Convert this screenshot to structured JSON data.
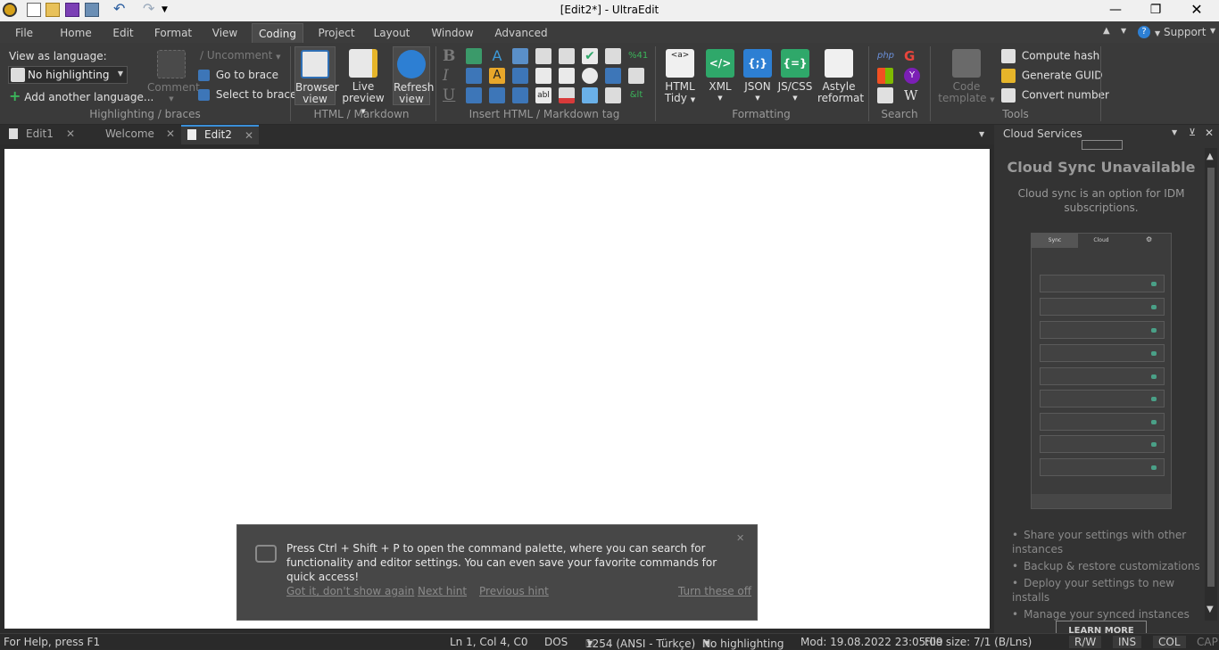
{
  "window": {
    "title": "[Edit2*] - UltraEdit"
  },
  "ribbon_tabs": [
    "File",
    "Home",
    "Edit",
    "Format",
    "View",
    "Coding",
    "Project",
    "Layout",
    "Window",
    "Advanced"
  ],
  "ribbon_right": {
    "support": "Support"
  },
  "highlighting": {
    "view_as_label": "View as language:",
    "language_value": "No highlighting",
    "add_language": "Add another language...",
    "comment": "Comment",
    "uncomment": "Uncomment",
    "go_to_brace": "Go to brace",
    "select_to_brace": "Select to brace",
    "group_label": "Highlighting / braces"
  },
  "html_markdown": {
    "browser_view": [
      "Browser",
      "view"
    ],
    "live_preview": [
      "Live",
      "preview"
    ],
    "refresh_view": [
      "Refresh",
      "view"
    ],
    "group_label": "HTML / Markdown"
  },
  "insert_tag": {
    "group_label": "Insert HTML / Markdown tag"
  },
  "formatting": {
    "html_tidy": [
      "HTML",
      "Tidy"
    ],
    "xml": "XML",
    "json": "JSON",
    "jscss": "JS/CSS",
    "astyle": [
      "Astyle",
      "reformat"
    ],
    "group_label": "Formatting",
    "xml_icon": "</>",
    "json_icon": "{;}",
    "jscss_icon": "{=}"
  },
  "search": {
    "group_label": "Search"
  },
  "tools": {
    "code_template": [
      "Code",
      "template"
    ],
    "compute_hash": "Compute hash",
    "generate_guid": "Generate GUID",
    "convert_number": "Convert number",
    "group_label": "Tools"
  },
  "doc_tabs": [
    {
      "label": "Edit1"
    },
    {
      "label": "Welcome"
    },
    {
      "label": "Edit2"
    }
  ],
  "hint": {
    "message": "Press Ctrl + Shift + P to open the command palette, where you can search for functionality and editor settings. You can even save your favorite commands for quick access!",
    "got_it": "Got it, don't show again",
    "next_hint": "Next hint",
    "previous_hint": "Previous hint",
    "turn_off": "Turn these off"
  },
  "cloud_panel": {
    "header": "Cloud Services",
    "title": "Cloud Sync Unavailable",
    "subtitle": "Cloud sync is an option for IDM subscriptions.",
    "preview_tabs": [
      "Sync",
      "Cloud"
    ],
    "bullets": [
      "Share your settings with other instances",
      "Backup & restore customizations",
      "Deploy your settings to new installs",
      "Manage your synced instances"
    ],
    "learn_more": "LEARN MORE"
  },
  "status": {
    "help": "For Help, press F1",
    "position": "Ln 1, Col 4, C0",
    "line_ending": "DOS",
    "encoding": "1254  (ANSI - Türkçe)",
    "highlighting": "No highlighting",
    "modified": "Mod: 19.08.2022 23:05:09",
    "file_size": "File size: 7/1 (B/Lns)",
    "rw": "R/W",
    "ins": "INS",
    "col": "COL",
    "cap": "CAP"
  },
  "colors": {
    "accent": "#3a8fd8",
    "green_icon": "#2fa86a",
    "blue_icon": "#2d7fd3"
  }
}
